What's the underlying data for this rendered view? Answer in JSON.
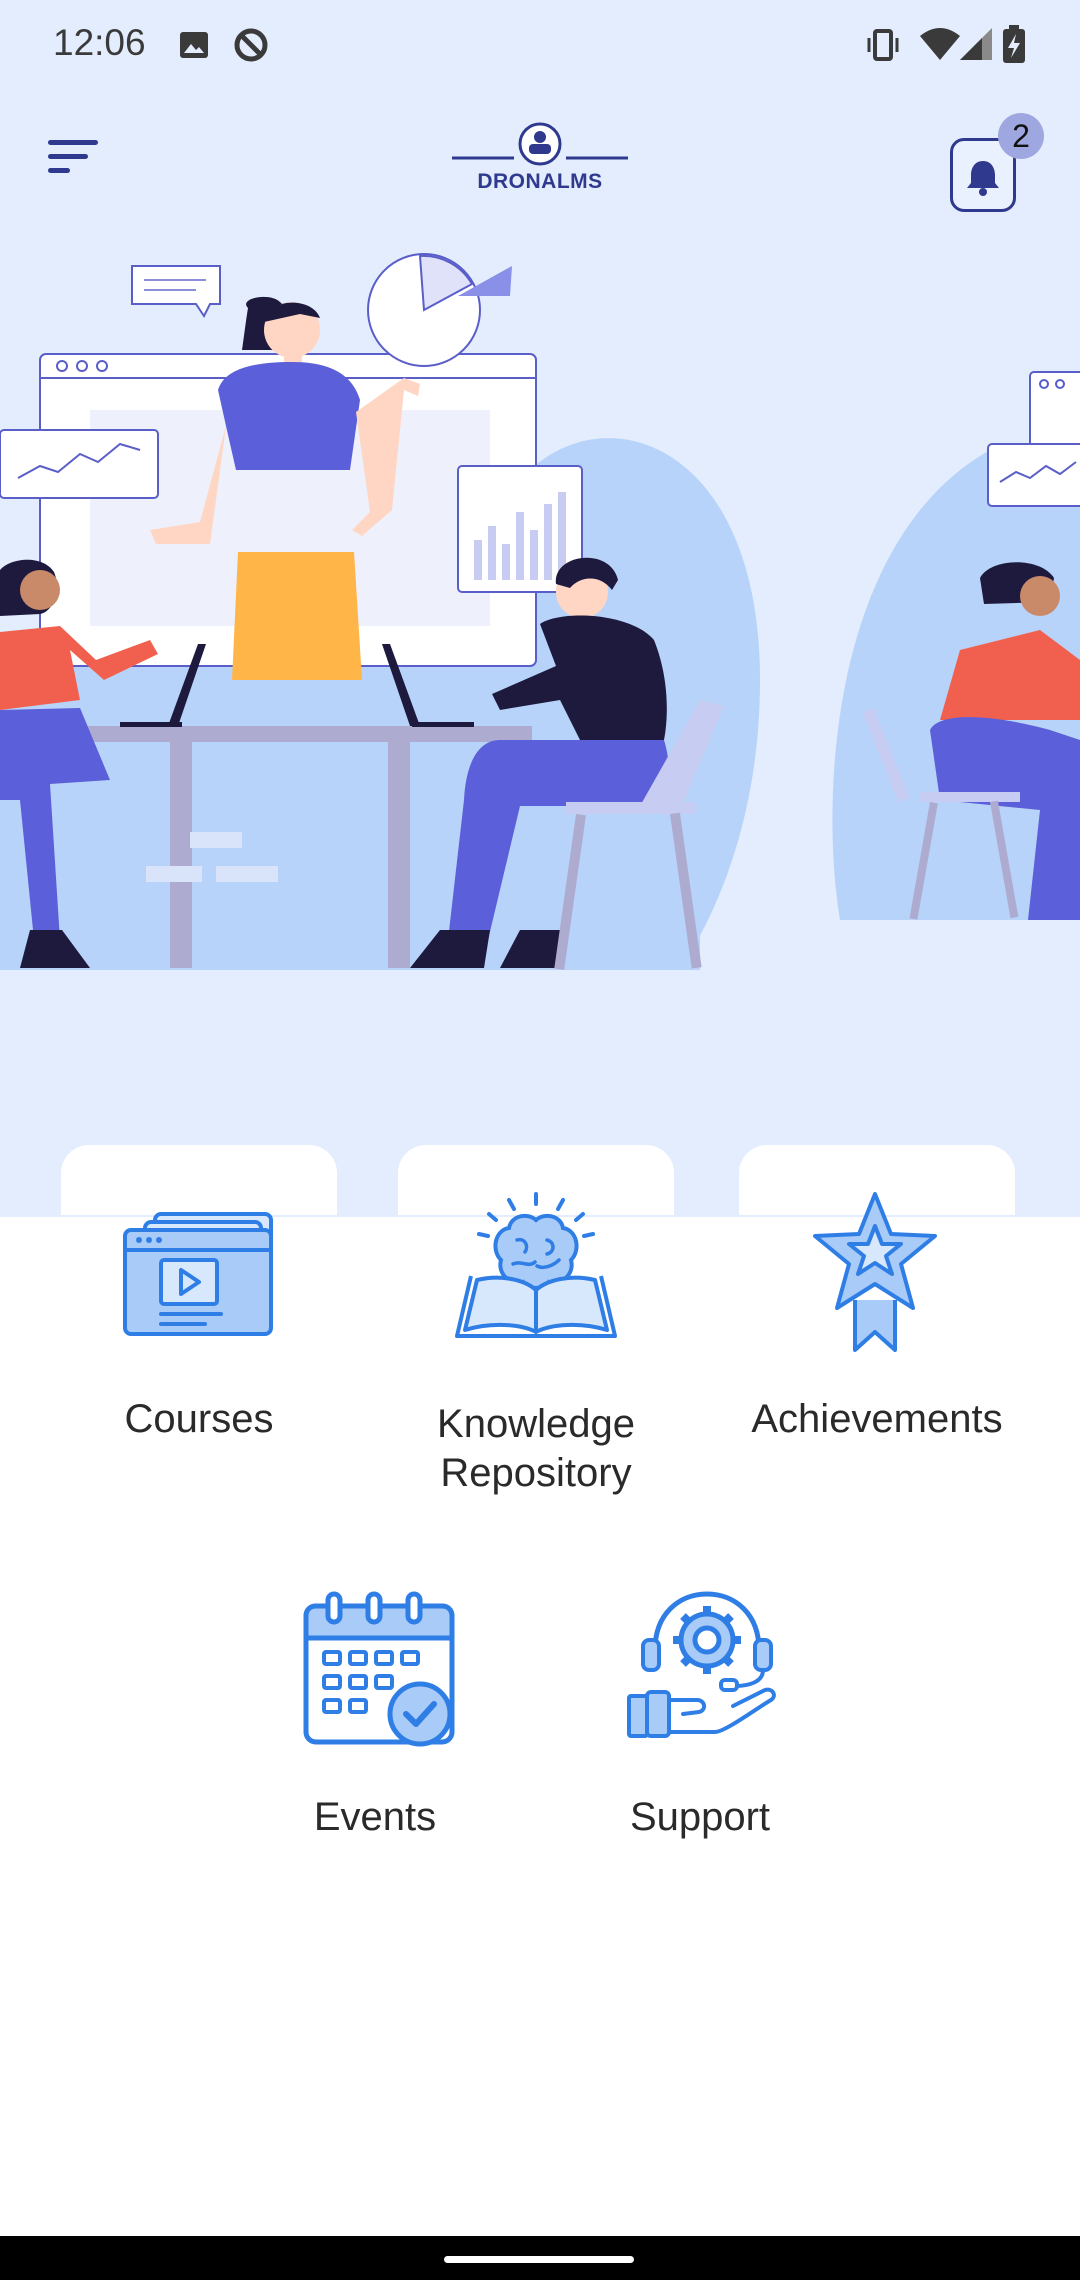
{
  "status_bar": {
    "time": "12:06",
    "icons": [
      "image-icon",
      "sync-disabled-icon",
      "vibrate-icon",
      "wifi-icon",
      "signal-icon",
      "battery-charging-icon"
    ]
  },
  "app_bar": {
    "menu_icon": "menu-icon",
    "logo_text": "DRONALMS",
    "notification_icon": "bell-icon",
    "notification_count": "2"
  },
  "hero": {
    "illustration": "team-meeting-illustration"
  },
  "tiles": [
    {
      "id": "courses",
      "label": "Courses",
      "icon": "video-course-icon"
    },
    {
      "id": "knowledge",
      "label": "Knowledge Repository",
      "icon": "brain-book-icon"
    },
    {
      "id": "achievements",
      "label": "Achievements",
      "icon": "star-award-icon"
    },
    {
      "id": "events",
      "label": "Events",
      "icon": "calendar-check-icon"
    },
    {
      "id": "support",
      "label": "Support",
      "icon": "support-hand-gear-icon"
    }
  ],
  "colors": {
    "background_top": "#e3edfd",
    "accent": "#2f3a8f",
    "icon_blue": "#2f7ee6",
    "icon_fill": "#a9cbf7",
    "badge": "#9fa7e0"
  }
}
